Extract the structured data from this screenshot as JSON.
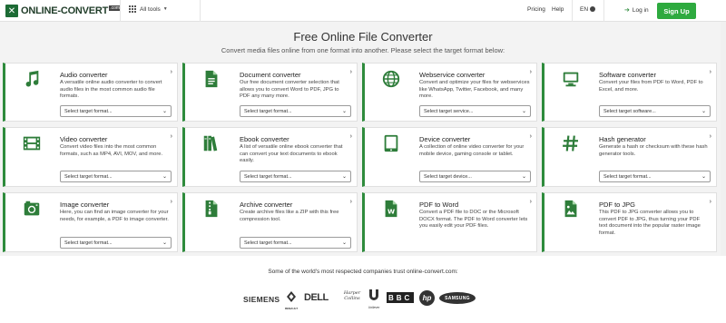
{
  "header": {
    "logo_text": "ONLINE-CONVERT",
    "logo_tld": ".com",
    "all_tools": "All tools",
    "pricing": "Pricing",
    "help": "Help",
    "language": "EN",
    "login": "Log in",
    "signup": "Sign Up"
  },
  "hero": {
    "title": "Free Online File Converter",
    "subtitle": "Convert media files online from one format into another. Please select the target format below:"
  },
  "cards": [
    {
      "title": "Audio converter",
      "icon": "music-note-icon",
      "desc": "A versatile online audio converter to convert audio files in the most common audio file formats.",
      "select": "Select target format..."
    },
    {
      "title": "Document converter",
      "icon": "document-icon",
      "desc": "Our free document converter selection that allows you to convert Word to PDF, JPG to PDF any many more.",
      "select": "Select target format..."
    },
    {
      "title": "Webservice converter",
      "icon": "globe-icon",
      "desc": "Convert and optimize your files for webservices like WhatsApp, Twitter, Facebook, and many more.",
      "select": "Select target service..."
    },
    {
      "title": "Software converter",
      "icon": "monitor-icon",
      "desc": "Convert your files from PDF to Word, PDF to Excel, and more.",
      "select": "Select target software..."
    },
    {
      "title": "Video converter",
      "icon": "film-icon",
      "desc": "Convert video files into the most common formats, such as MP4, AVI, MOV, and more.",
      "select": "Select target format..."
    },
    {
      "title": "Ebook converter",
      "icon": "books-icon",
      "desc": "A list of versatile online ebook converter that can convert your text documents to ebook easily.",
      "select": "Select target format..."
    },
    {
      "title": "Device converter",
      "icon": "tablet-icon",
      "desc": "A collection of online video converter for your mobile device, gaming console or tablet.",
      "select": "Select target device..."
    },
    {
      "title": "Hash generator",
      "icon": "hash-icon",
      "desc": "Generate a hash or checksum with these hash generator tools.",
      "select": "Select target format..."
    },
    {
      "title": "Image converter",
      "icon": "camera-icon",
      "desc": "Here, you can find an image converter for your needs, for example, a PDF to image converter.",
      "select": "Select target format..."
    },
    {
      "title": "Archive converter",
      "icon": "archive-icon",
      "desc": "Create archive files like a ZIP with this free compression tool.",
      "select": "Select target format..."
    },
    {
      "title": "PDF to Word",
      "icon": "word-file-icon",
      "desc": "Convert a PDF file to DOC or the Microsoft DOCX format. The PDF to Word converter lets you easily edit your PDF files.",
      "select": ""
    },
    {
      "title": "PDF to JPG",
      "icon": "image-file-icon",
      "desc": "This PDF to JPG converter allows you to convert PDF to JPG, thus turning your PDF text document into the popular raster image format.",
      "select": ""
    }
  ],
  "trust": {
    "title": "Some of the world's most respected companies trust online-convert.com:",
    "brands": [
      "SIEMENS",
      "RENAULT",
      "DELL",
      "Harper Collins",
      "Unilever",
      "BBC",
      "hp",
      "SAMSUNG"
    ]
  },
  "colors": {
    "accent": "#2e8b3c",
    "signup": "#2eaa3f"
  }
}
